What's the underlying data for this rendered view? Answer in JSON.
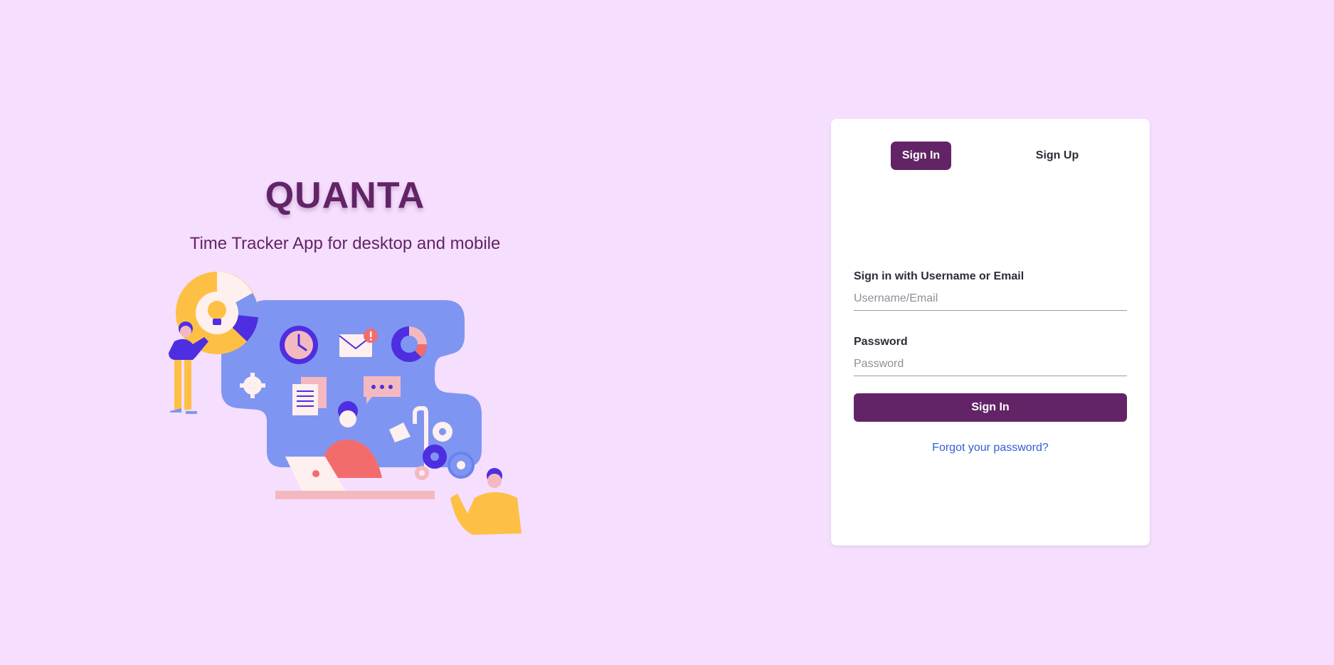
{
  "hero": {
    "brand": "QUANTA",
    "tagline": "Time Tracker App for desktop and mobile"
  },
  "auth_tabs": {
    "signin_label": "Sign In",
    "signup_label": "Sign Up",
    "active": "signin"
  },
  "signin_form": {
    "username_label": "Sign in with Username or Email",
    "username_placeholder": "Username/Email",
    "username_value": "",
    "password_label": "Password",
    "password_placeholder": "Password",
    "password_value": "",
    "submit_label": "Sign In",
    "forgot_label": "Forgot your password?"
  },
  "colors": {
    "background": "#f5defe",
    "brand": "#622466",
    "link": "#2f5fd6"
  },
  "icons": {
    "illustration": "team-productivity-illustration"
  }
}
